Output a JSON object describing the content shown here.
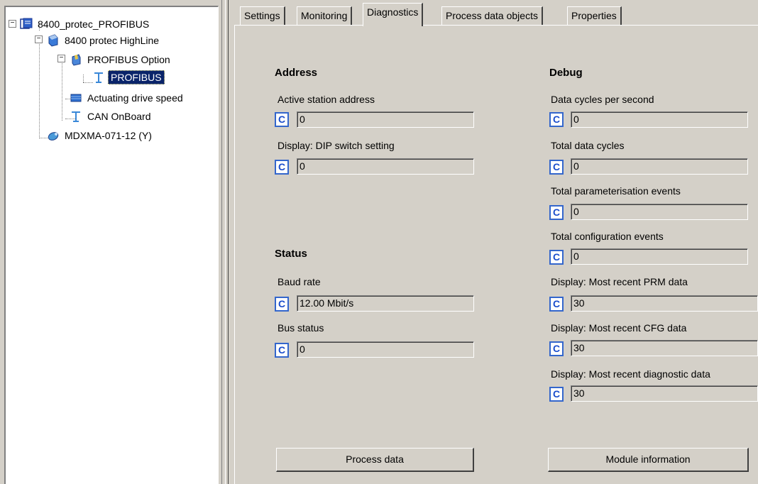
{
  "tree": {
    "items": [
      {
        "label": "8400_protec_PROFIBUS",
        "icon": "project-icon",
        "expanded": true
      },
      {
        "label": "8400 protec HighLine",
        "icon": "device-icon",
        "expanded": true
      },
      {
        "label": "PROFIBUS Option",
        "icon": "module-icon",
        "expanded": true
      },
      {
        "label": "PROFIBUS",
        "icon": "bus-icon",
        "selected": true
      },
      {
        "label": "Actuating drive speed",
        "icon": "drive-icon"
      },
      {
        "label": "CAN OnBoard",
        "icon": "bus-icon"
      },
      {
        "label": "MDXMA-071-12 (Y)",
        "icon": "motor-icon"
      }
    ]
  },
  "tabs": [
    {
      "label": "Settings"
    },
    {
      "label": "Monitoring"
    },
    {
      "label": "Diagnostics",
      "active": true
    },
    {
      "label": "Process data objects"
    },
    {
      "label": "Properties"
    }
  ],
  "address": {
    "title": "Address",
    "active_station_label": "Active station address",
    "active_station_value": "0",
    "dip_label": "Display: DIP switch setting",
    "dip_value": "0"
  },
  "status": {
    "title": "Status",
    "baud_label": "Baud rate",
    "baud_value": "12.00 Mbit/s",
    "bus_label": "Bus status",
    "bus_value": "0"
  },
  "debug": {
    "title": "Debug",
    "fields": [
      {
        "label": "Data cycles per second",
        "value": "0"
      },
      {
        "label": "Total data cycles",
        "value": "0"
      },
      {
        "label": "Total parameterisation events",
        "value": "0"
      },
      {
        "label": "Total configuration events",
        "value": "0"
      },
      {
        "label": "Display: Most recent PRM data",
        "value": "30"
      },
      {
        "label": "Display: Most recent CFG data",
        "value": "30"
      },
      {
        "label": "Display: Most recent diagnostic data",
        "value": "30"
      }
    ]
  },
  "c_label": "C",
  "buttons": {
    "process_data": "Process data",
    "module_info": "Module information"
  },
  "colors": {
    "background": "#d4d0c8",
    "selection": "#0a246a",
    "c_button": "#3366cc"
  }
}
